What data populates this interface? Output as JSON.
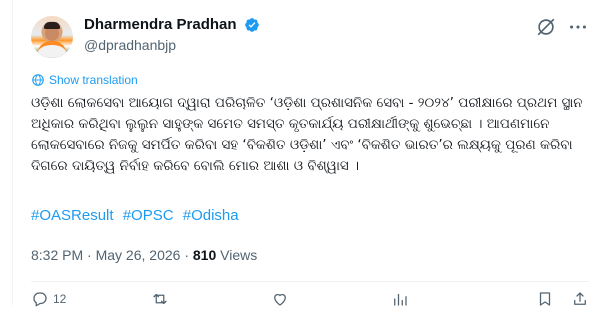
{
  "author": {
    "display_name": "Dharmendra Pradhan",
    "handle": "@dpradhanbjp"
  },
  "translate_link": "Show translation",
  "post": {
    "text": "ଓଡ଼ିଶା ଲୋକସେବା ଆୟୋଗ ଦ୍ୱାରା ପରିଚାଳିତ ‘ଓଡ଼ିଶା ପ୍ରଶାସନିକ ସେବା - ୨୦୨୪’ ପରୀକ୍ଷାରେ ପ୍ରଥମ ସ୍ଥାନ ଅଧିକାର କରିଥିବା ଲୁଲୁନ ସାହୁଙ୍କ ସମେତ ସମସ୍ତ କୃତକାର୍ଯ୍ୟ ପରୀକ୍ଷାର୍ଥୀଙ୍କୁ ଶୁଭେଚ୍ଛା । ଆପଣମାନେ ଲୋକସେବାରେ ନିଜକୁ ସମର୍ପିତ କରିବା ସହ ‘ବିକଶିତ ଓଡ଼ିଶା’ ଏବଂ ‘ବିକଶିତ ଭାରତ’ର ଲକ୍ଷ୍ୟକୁ ପୂରଣ କରିବା ଦିଗରେ ଦାୟିତ୍ୱ ନିର୍ବାହ କରିବେ ବୋଲି ମୋର ଆଶା ଓ ବିଶ୍ୱାସ ।",
    "hashtags": [
      "#OASResult",
      "#OPSC",
      "#Odisha"
    ]
  },
  "meta": {
    "time": "8:32 PM",
    "separator": "·",
    "date": "May 26, 2026",
    "views_count": "810",
    "views_label": "Views"
  },
  "actions": {
    "reply_count": "12"
  },
  "colors": {
    "accent": "#1d9bf0",
    "text_primary": "#0f1419",
    "text_secondary": "#536471",
    "divider": "#eff3f4",
    "verified": "#1d9bf0"
  },
  "icons": [
    "verified-badge-icon",
    "grok-icon",
    "more-icon",
    "globe-icon",
    "reply-icon",
    "retweet-icon",
    "like-icon",
    "views-icon",
    "bookmark-icon",
    "share-icon"
  ]
}
